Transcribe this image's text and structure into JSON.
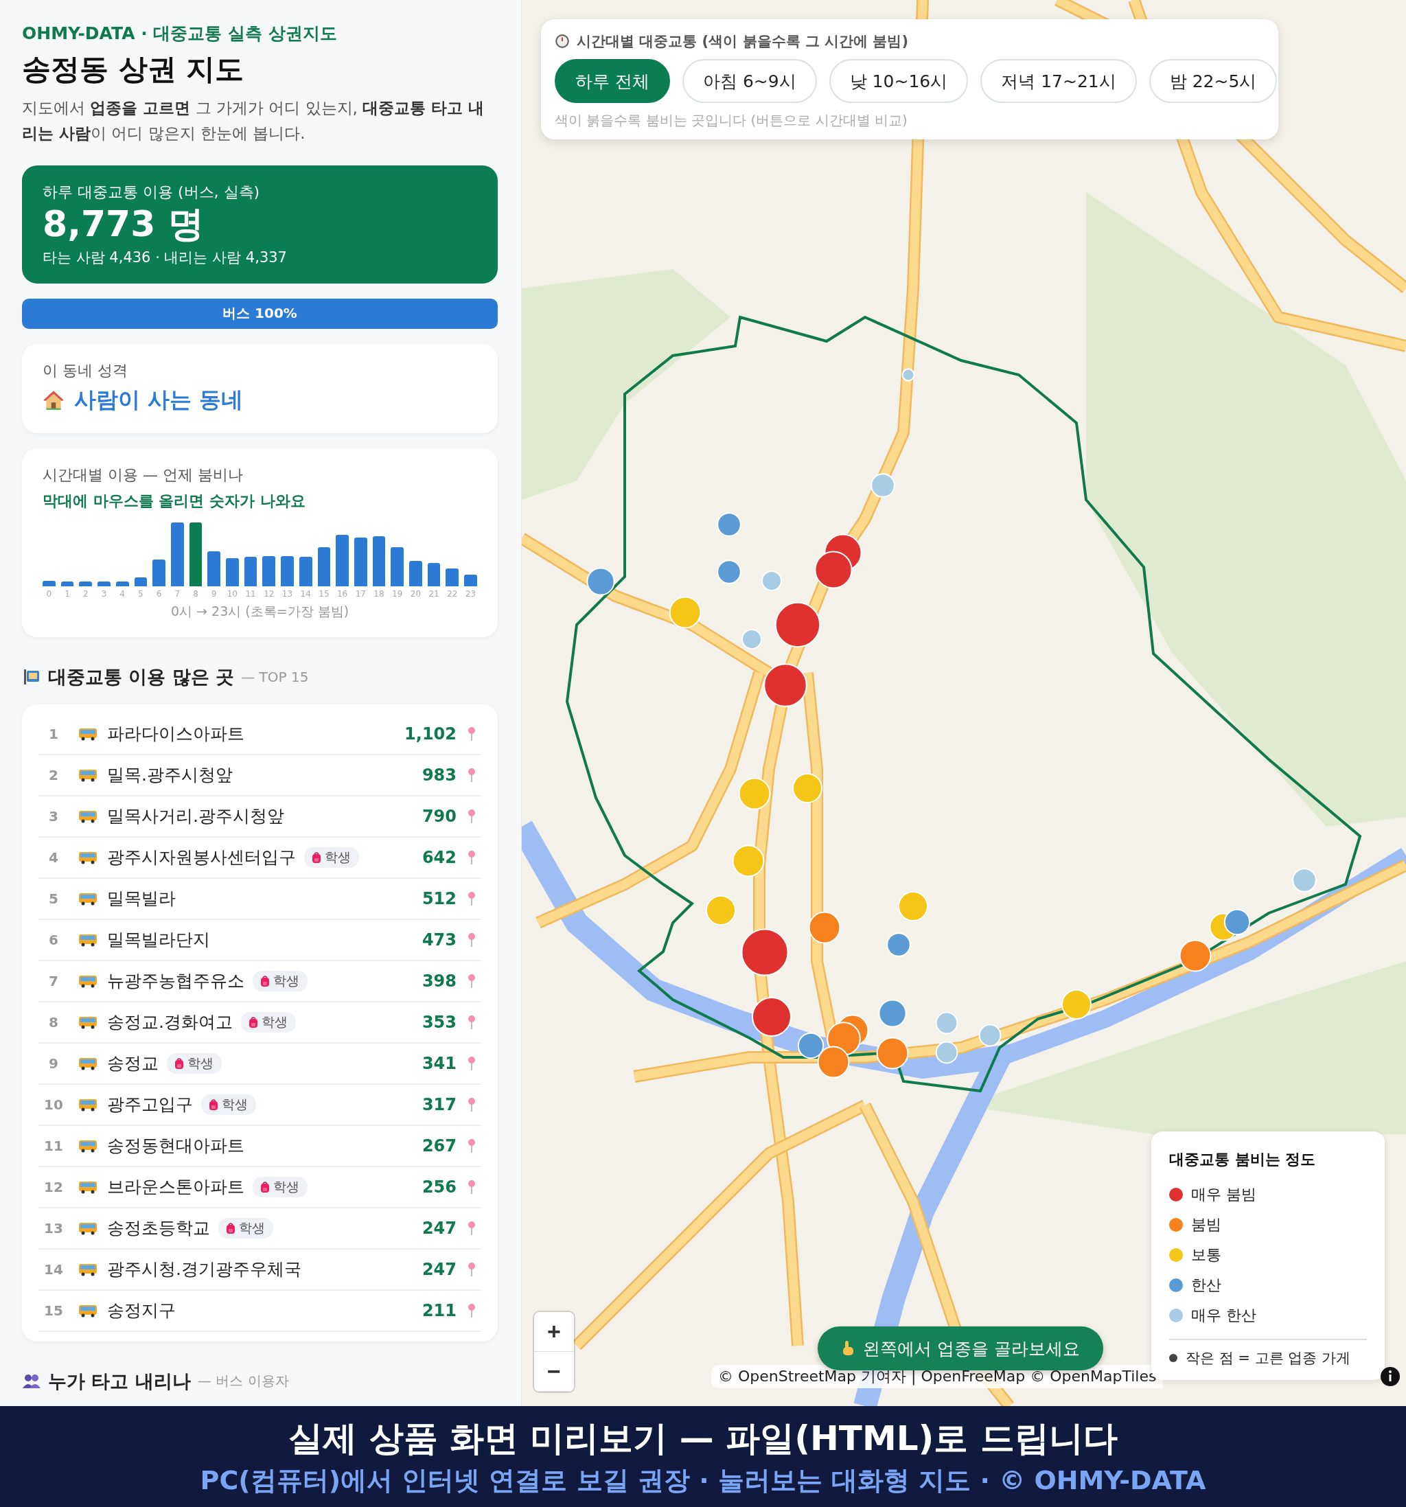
{
  "brand": "OHMY-DATA · 대중교통 실측 상권지도",
  "title": "송정동 상권 지도",
  "intro": "지도에서 **업종을 고르면** 그 가게가 어디 있는지, **대중교통 타고 내리는 사람**이 어디 많은지 한눈에 봅니다.",
  "summary": {
    "label": "하루 대중교통 이용 (버스, 실측)",
    "total": "8,773 명",
    "detail": "타는 사람 4,436 · 내리는 사람 4,337"
  },
  "mode_bar": {
    "label": "버스 100%",
    "level": 1
  },
  "character": {
    "label": "이 동네 성격",
    "value": "사람이 사는 동네"
  },
  "hourly": {
    "title": "시간대별 이용 — 언제 붐비나",
    "hint": "막대에 마우스를 올리면 숫자가 나와요",
    "caption": "0시 → 23시 (초록=가장 붐빔)",
    "hours": [
      {
        "label": "0",
        "peak": false
      },
      {
        "label": "1",
        "peak": false
      },
      {
        "label": "2",
        "peak": false
      },
      {
        "label": "3",
        "peak": false
      },
      {
        "label": "4",
        "peak": false
      },
      {
        "label": "5",
        "peak": false
      },
      {
        "label": "6",
        "peak": false
      },
      {
        "label": "7",
        "peak": false
      },
      {
        "label": "8",
        "peak": true
      },
      {
        "label": "9",
        "peak": false
      },
      {
        "label": "10",
        "peak": false
      },
      {
        "label": "11",
        "peak": false
      },
      {
        "label": "12",
        "peak": false
      },
      {
        "label": "13",
        "peak": false
      },
      {
        "label": "14",
        "peak": false
      },
      {
        "label": "15",
        "peak": false
      },
      {
        "label": "16",
        "peak": false
      },
      {
        "label": "17",
        "peak": false
      },
      {
        "label": "18",
        "peak": false
      },
      {
        "label": "19",
        "peak": false
      },
      {
        "label": "20",
        "peak": false
      },
      {
        "label": "21",
        "peak": false
      },
      {
        "label": "22",
        "peak": false
      },
      {
        "label": "23",
        "peak": false
      }
    ]
  },
  "top_stops": {
    "title": "대중교통 이용 많은 곳",
    "suffix": "— TOP 15",
    "rows": [
      {
        "rank": "1",
        "name": "파라다이스아파트",
        "count": "1,102"
      },
      {
        "rank": "2",
        "name": "밀목.광주시청앞",
        "count": "983"
      },
      {
        "rank": "3",
        "name": "밀목사거리.광주시청앞",
        "count": "790"
      },
      {
        "rank": "4",
        "name": "광주시자원봉사센터입구",
        "tag": "학생",
        "count": "642"
      },
      {
        "rank": "5",
        "name": "밀목빌라",
        "count": "512"
      },
      {
        "rank": "6",
        "name": "밀목빌라단지",
        "count": "473"
      },
      {
        "rank": "7",
        "name": "뉴광주농협주유소",
        "tag": "학생",
        "count": "398"
      },
      {
        "rank": "8",
        "name": "송정교.경화여고",
        "tag": "학생",
        "count": "353"
      },
      {
        "rank": "9",
        "name": "송정교",
        "tag": "학생",
        "count": "341"
      },
      {
        "rank": "10",
        "name": "광주고입구",
        "tag": "학생",
        "count": "317"
      },
      {
        "rank": "11",
        "name": "송정동현대아파트",
        "count": "267"
      },
      {
        "rank": "12",
        "name": "브라운스톤아파트",
        "tag": "학생",
        "count": "256"
      },
      {
        "rank": "13",
        "name": "송정초등학교",
        "tag": "학생",
        "count": "247"
      },
      {
        "rank": "14",
        "name": "광주시청.경기광주우체국",
        "count": "247"
      },
      {
        "rank": "15",
        "name": "송정지구",
        "count": "211"
      }
    ]
  },
  "riders": {
    "title": "누가 타고 내리나",
    "suffix": "— 버스 이용자"
  },
  "map": {
    "filter": {
      "title": "시간대별 대중교통 (색이 붉을수록 그 시간에 붐빔)",
      "buttons": [
        {
          "label": "하루 전체",
          "selected": true
        },
        {
          "label": "아침 6~9시",
          "selected": false
        },
        {
          "label": "낮 10~16시",
          "selected": false
        },
        {
          "label": "저녁 17~21시",
          "selected": false
        },
        {
          "label": "밤 22~5시",
          "selected": false
        }
      ],
      "hint": "색이 붉을수록 붐비는 곳입니다 (버튼으로 시간대별 비교)"
    },
    "legend": {
      "title": "대중교통 붐비는 정도",
      "items": [
        {
          "label": "매우 붐빔",
          "color": "#e03131"
        },
        {
          "label": "붐빔",
          "color": "#f5821f"
        },
        {
          "label": "보통",
          "color": "#f5c518"
        },
        {
          "label": "한산",
          "color": "#5b9bd5"
        },
        {
          "label": "매우 한산",
          "color": "#a8cce4"
        }
      ],
      "note": "작은 점 = 고른 업종 가게"
    },
    "prompt": "왼쪽에서 업종을 골라보세요",
    "zoom": [
      "+",
      "−"
    ],
    "attribution": "© OpenStreetMap 기여자 | OpenFreeMap © OpenMapTiles"
  },
  "banner": {
    "title": "실제 상품 화면 미리보기 — 파일(HTML)로 드립니다",
    "subtitle": "PC(컴퓨터)에서 인터넷 연결로 보길 권장 · 눌러보는 대화형 지도 · © OHMY-DATA"
  }
}
